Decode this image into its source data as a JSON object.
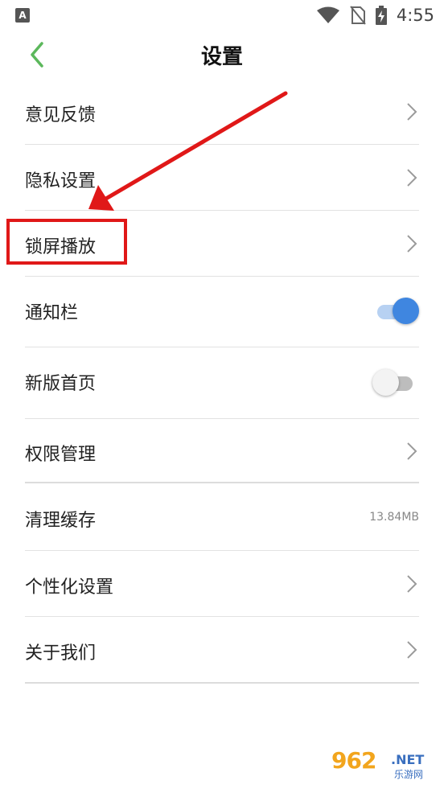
{
  "status_bar": {
    "app_icon": "A",
    "time": "4:55",
    "icons": [
      "wifi-icon",
      "no-sim-icon",
      "battery-charging-icon"
    ]
  },
  "header": {
    "title": "设置",
    "back_icon": "chevron-left-icon",
    "accent_color": "#5cb85c"
  },
  "settings": {
    "items": [
      {
        "label": "意见反馈",
        "control": "chevron"
      },
      {
        "label": "隐私设置",
        "control": "chevron"
      },
      {
        "label": "锁屏播放",
        "control": "chevron",
        "highlighted": true
      },
      {
        "label": "通知栏",
        "control": "toggle",
        "state": "on"
      },
      {
        "label": "新版首页",
        "control": "toggle",
        "state": "off"
      },
      {
        "label": "权限管理",
        "control": "chevron"
      },
      {
        "label": "清理缓存",
        "control": "value",
        "value": "13.84MB"
      },
      {
        "label": "个性化设置",
        "control": "chevron"
      },
      {
        "label": "关于我们",
        "control": "chevron"
      }
    ]
  },
  "annotation": {
    "color": "#e01818"
  },
  "watermark": {
    "logo": "962",
    "suffix": ".NET",
    "sub": "乐游网"
  }
}
